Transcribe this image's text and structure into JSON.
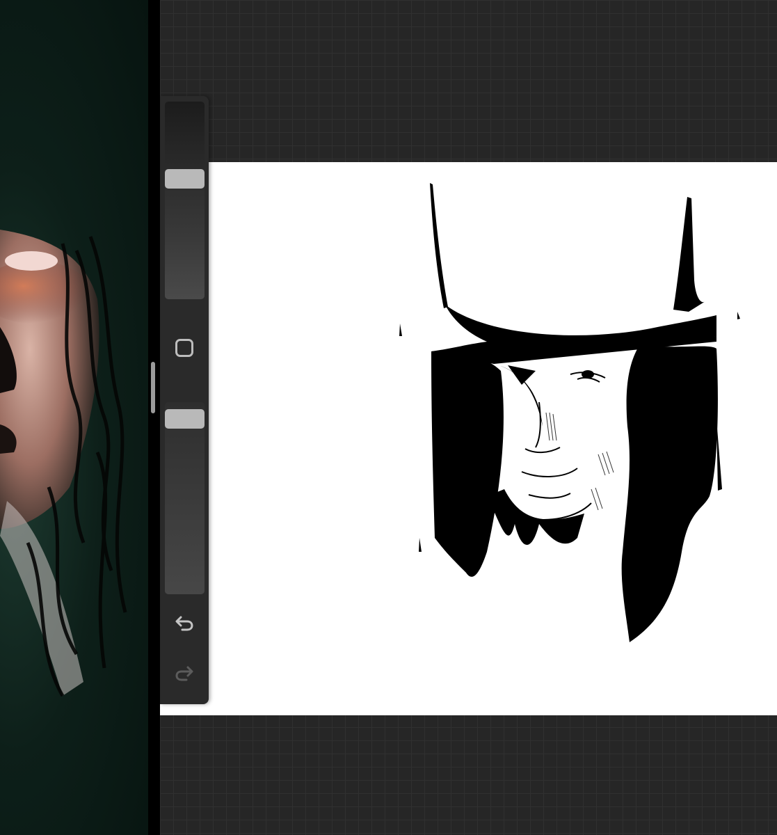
{
  "app": {
    "name": ""
  },
  "reference": {
    "kind": "photo"
  },
  "sidebar": {
    "brush_size_level": 0.62,
    "opacity_level": 0.96,
    "modify_icon": "square-modify-icon",
    "undo_icon": "undo-icon",
    "redo_icon": "redo-icon",
    "redo_enabled": false
  },
  "colors": {
    "workspace": "#262626",
    "sidebar": "#2a2a2a",
    "thumb": "#b9b9b9",
    "canvas": "#ffffff"
  }
}
